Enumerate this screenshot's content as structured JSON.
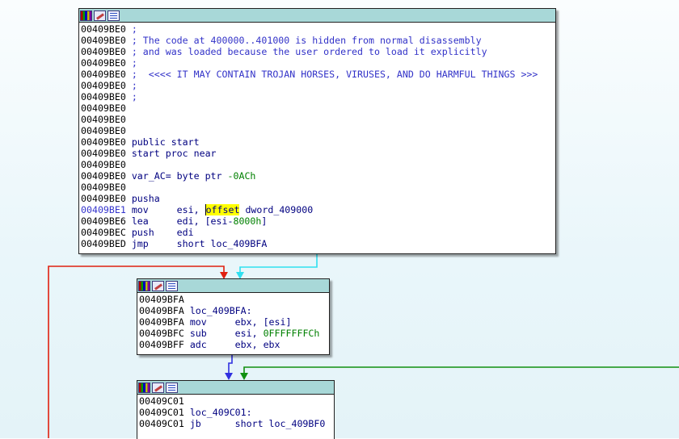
{
  "node1": {
    "lines": [
      {
        "addr": "00409BE0",
        "text": ";",
        "kind": "cmt"
      },
      {
        "addr": "00409BE0",
        "text": "; The code at 400000..401000 is hidden from normal disassembly",
        "kind": "cmt"
      },
      {
        "addr": "00409BE0",
        "text": "; and was loaded because the user ordered to load it explicitly",
        "kind": "cmt"
      },
      {
        "addr": "00409BE0",
        "text": ";",
        "kind": "cmt"
      },
      {
        "addr": "00409BE0",
        "text": ";  <<<< IT MAY CONTAIN TROJAN HORSES, VIRUSES, AND DO HARMFUL THINGS >>>",
        "kind": "cmt"
      },
      {
        "addr": "00409BE0",
        "text": ";",
        "kind": "cmt"
      },
      {
        "addr": "00409BE0",
        "text": ";",
        "kind": "cmt"
      },
      {
        "addr": "00409BE0",
        "text": "",
        "kind": "code"
      },
      {
        "addr": "00409BE0",
        "text": "",
        "kind": "code"
      },
      {
        "addr": "00409BE0",
        "text": "",
        "kind": "code"
      },
      {
        "addr": "00409BE0",
        "text": "public start",
        "kind": "code"
      },
      {
        "addr": "00409BE0",
        "text": "start proc near",
        "kind": "code"
      },
      {
        "addr": "00409BE0",
        "text": "",
        "kind": "code"
      },
      {
        "addr": "00409BE0",
        "pre": "var_AC= byte ptr ",
        "num": "-0ACh",
        "kind": "mix"
      },
      {
        "addr": "00409BE0",
        "text": "",
        "kind": "code"
      },
      {
        "addr": "00409BE0",
        "text": "pusha",
        "kind": "code"
      },
      {
        "addr": "00409BE1",
        "pre": "mov     esi, ",
        "hl": "offset",
        "post": " dword_409000",
        "kind": "hl",
        "current": true
      },
      {
        "addr": "00409BE6",
        "pre": "lea     edi, [esi-",
        "num": "8000h",
        "post": "]",
        "kind": "mix"
      },
      {
        "addr": "00409BEC",
        "text": "push    edi",
        "kind": "code"
      },
      {
        "addr": "00409BED",
        "text": "jmp     short loc_409BFA",
        "kind": "code"
      }
    ]
  },
  "node2": {
    "lines": [
      {
        "addr": "00409BFA",
        "text": "",
        "kind": "code"
      },
      {
        "addr": "00409BFA",
        "text": "loc_409BFA:",
        "kind": "code"
      },
      {
        "addr": "00409BFA",
        "text": "mov     ebx, [esi]",
        "kind": "code"
      },
      {
        "addr": "00409BFC",
        "pre": "sub     esi, ",
        "num": "0FFFFFFFCh",
        "kind": "mix"
      },
      {
        "addr": "00409BFF",
        "text": "adc     ebx, ebx",
        "kind": "code"
      }
    ]
  },
  "node3": {
    "lines": [
      {
        "addr": "00409C01",
        "text": "",
        "kind": "code"
      },
      {
        "addr": "00409C01",
        "text": "loc_409C01:",
        "kind": "code"
      },
      {
        "addr": "00409C01",
        "text": "jb      short loc_409BF0",
        "kind": "code"
      }
    ]
  },
  "colors": {
    "edge_red": "#e02010",
    "edge_cyan": "#30e0f0",
    "edge_blue": "#3030e0",
    "edge_green": "#109010",
    "header_bg": "#a8d8d8"
  },
  "icons": [
    "graph-overview-icon",
    "edit-node-icon",
    "text-view-icon"
  ]
}
